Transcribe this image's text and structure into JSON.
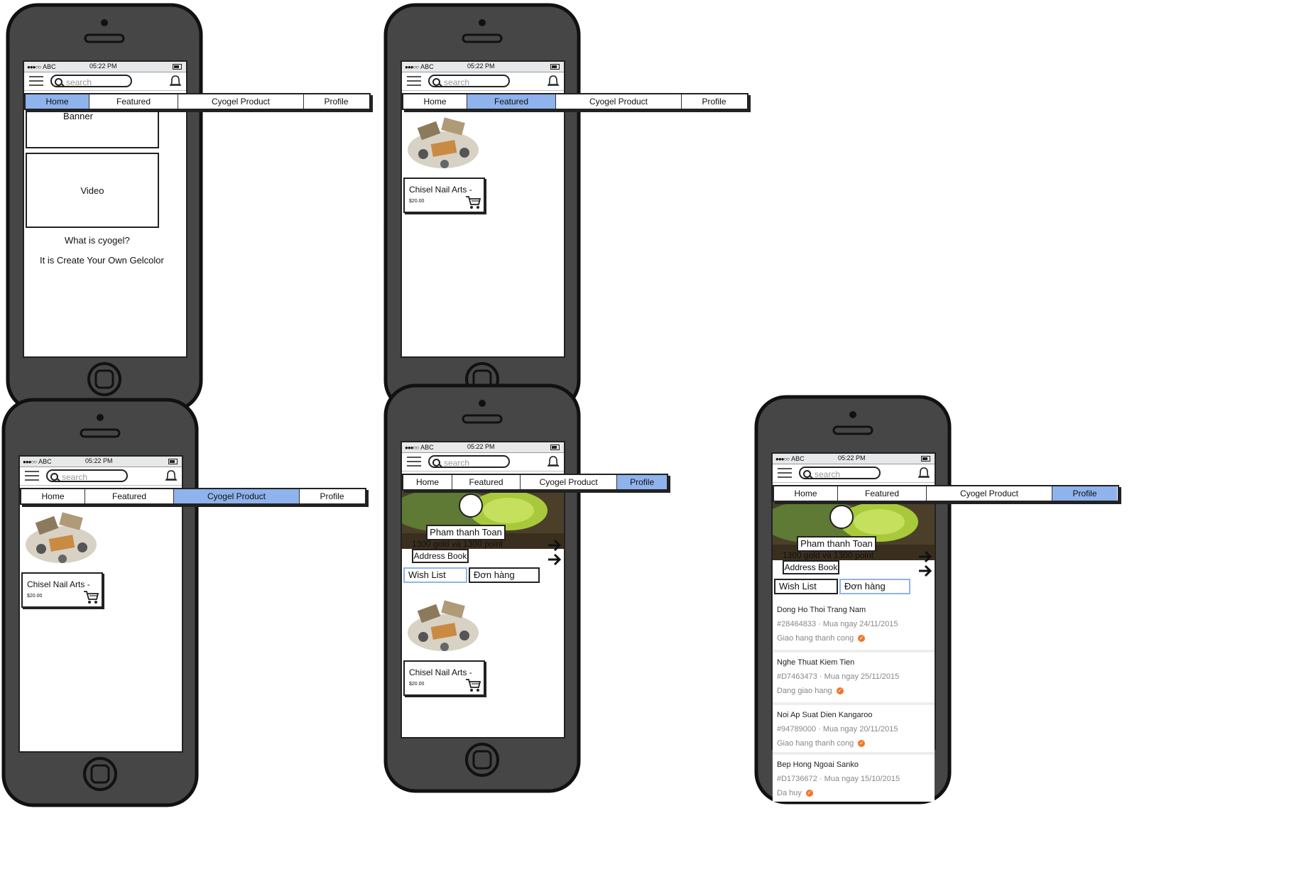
{
  "status": {
    "signal": "●●●○○",
    "carrier": "ABC",
    "time": "05:22 PM"
  },
  "search": {
    "placeholder": "search"
  },
  "tabs": [
    "Home",
    "Featured",
    "Cyogel Product",
    "Profile"
  ],
  "home": {
    "banner": "Banner",
    "video": "Video",
    "question": "What is cyogel?",
    "answer": "It is Create Your Own Gelcolor"
  },
  "product": {
    "name": "Chisel Nail Arts -",
    "price": "$20.00"
  },
  "profile": {
    "username": "Pham thanh Toan",
    "points": "1300 gold và 1300 point",
    "address_book": "Address Book",
    "wish_list": "Wish List",
    "orders_tab": "Đơn hàng"
  },
  "orders": [
    {
      "title": "Dong Ho Thoi Trang Nam",
      "meta": "#28464833 · Mua ngay 24/11/2015",
      "status": "Giao hang thanh cong"
    },
    {
      "title": "Nghe Thuat Kiem Tien",
      "meta": "#D7463473 · Mua ngay 25/11/2015",
      "status": "Dang giao hang"
    },
    {
      "title": "Noi Ap Suat Dien Kangaroo",
      "meta": "#94789000 · Mua ngay 20/11/2015",
      "status": "Giao hang thanh cong"
    },
    {
      "title": "Bep Hong Ngoai Sanko",
      "meta": "#D1736672 · Mua ngay 15/10/2015",
      "status": "Da huy"
    }
  ],
  "colors": {
    "active_tab": "#8fb3ec",
    "phone_body": "#464646",
    "status_ok": "#f0762c"
  }
}
